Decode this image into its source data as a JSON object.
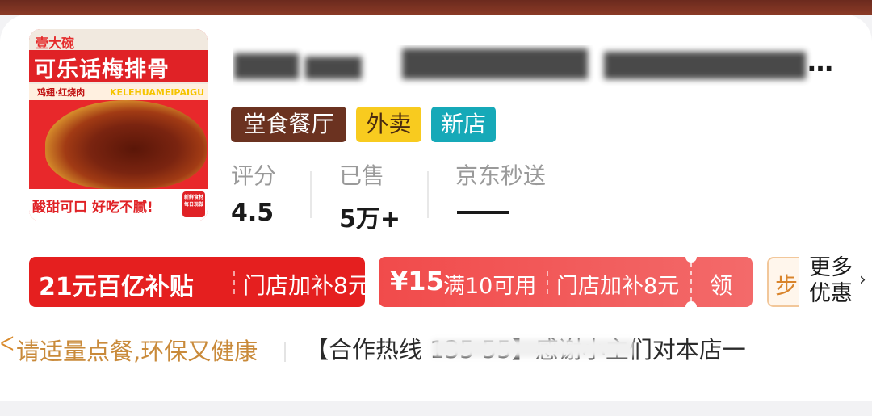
{
  "store": {
    "logo": {
      "brand": "壹大碗",
      "title": "可乐话梅排骨",
      "sub": "鸡翅·红烧肉",
      "eng": "KELEHUAMEIPAIGU",
      "slogan": "酸甜可口 好吃不腻!",
      "badge": "新鲜食材 每日现做"
    },
    "name_visible_suffix": "…"
  },
  "tags": [
    "堂食餐厅",
    "外卖",
    "新店"
  ],
  "stats": [
    {
      "label": "评分",
      "value": "4.5"
    },
    {
      "label": "已售",
      "value": "5万+"
    },
    {
      "label": "京东秒送",
      "value": ""
    }
  ],
  "coupons": {
    "subsidy": {
      "main": "21元百亿补贴",
      "sub": "门店加补8元"
    },
    "voucher": {
      "price": "¥15",
      "condition": "满10可用",
      "sub": "门店加补8元",
      "claim": "领"
    },
    "partial": "步",
    "more": "更多优惠",
    "more_arrow": "›"
  },
  "notice": {
    "icon": "leaf-icon",
    "text": "请适量点餐,环保又健康",
    "hotline": "【合作热线 135                 55】感谢小主们对本店一"
  },
  "colors": {
    "subsidy_red": "#e51f1f",
    "voucher_pink": "#f14b4b",
    "tag_dine": "#6b3220",
    "tag_delivery": "#f8cb1f",
    "tag_new": "#16a9b8",
    "notice_orange": "#c98a3a"
  }
}
